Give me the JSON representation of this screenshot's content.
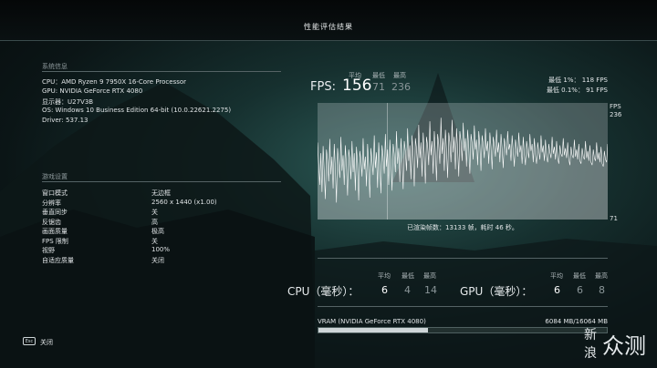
{
  "header": {
    "title": "性能评估结果"
  },
  "system_info": {
    "title": "系统信息",
    "lines": [
      "CPU：AMD Ryzen 9 7950X 16-Core Processor",
      "GPU: NVIDIA GeForce RTX 4080",
      "显示器：U27V3B",
      "OS: Windows 10 Business Edition 64-bit (10.0.22621.2275)",
      "Driver: 537.13"
    ]
  },
  "game_settings": {
    "title": "游戏设置",
    "rows": [
      {
        "label": "窗口模式",
        "value": "无边框"
      },
      {
        "label": "分辨率",
        "value": "2560 x 1440 (x1.00)"
      },
      {
        "label": "垂直同步",
        "value": "关"
      },
      {
        "label": "反锯齿",
        "value": "高"
      },
      {
        "label": "画面质量",
        "value": "极高"
      },
      {
        "label": "FPS 限制",
        "value": "关"
      },
      {
        "label": "视野",
        "value": "100%"
      },
      {
        "label": "自适应质量",
        "value": "关闭"
      }
    ]
  },
  "fps": {
    "label": "FPS:",
    "head_avg": "平均",
    "head_min": "最低",
    "head_max": "最高",
    "avg": "156",
    "min": "71",
    "max": "236",
    "low_1": "最低 1%： 118 FPS",
    "low_01": "最低 0.1%： 91 FPS"
  },
  "chart_data": {
    "type": "line",
    "y_top_label": "FPS",
    "y_top_value": "236",
    "y_bottom_value": "71",
    "ylim": [
      71,
      236
    ],
    "values": [
      180,
      150,
      120,
      165,
      110,
      175,
      140,
      100,
      170,
      155,
      125,
      185,
      135,
      160,
      115,
      178,
      145,
      95,
      172,
      150,
      130,
      188,
      140,
      162,
      120,
      176,
      148,
      105,
      170,
      158,
      128,
      182,
      138,
      165,
      112,
      174,
      150,
      98,
      168,
      156,
      132,
      186,
      142,
      160,
      118,
      178,
      146,
      102,
      172,
      154,
      134,
      190,
      144,
      166,
      116,
      180,
      150,
      108,
      176,
      160,
      136,
      192,
      146,
      170,
      120,
      184,
      152,
      112,
      178,
      164,
      138,
      196,
      150,
      172,
      124,
      186,
      156,
      114,
      182,
      168,
      140,
      200,
      154,
      176,
      128,
      190,
      160,
      118,
      186,
      172,
      144,
      205,
      158,
      180,
      132,
      194,
      164,
      122,
      188,
      176,
      148,
      210,
      162,
      182,
      136,
      196,
      166,
      126,
      192,
      178,
      150,
      215,
      164,
      186,
      140,
      198,
      170,
      130,
      194,
      180,
      152,
      212,
      166,
      188,
      142,
      200,
      172,
      132,
      196,
      182,
      154,
      208,
      168,
      186,
      146,
      198,
      174,
      136,
      192,
      180,
      156,
      204,
      170,
      184,
      148,
      196,
      176,
      140,
      190,
      178,
      158,
      200,
      168,
      182,
      150,
      194,
      174,
      142,
      188,
      176,
      160,
      198,
      166,
      180,
      152,
      192,
      172,
      144,
      186,
      174,
      162,
      196,
      170,
      178,
      154,
      190,
      168,
      146,
      184,
      172,
      160,
      194,
      166,
      176,
      150,
      188,
      164,
      148,
      182,
      170,
      158,
      192,
      168,
      178,
      152,
      186,
      162,
      150,
      180,
      168,
      156,
      190,
      166,
      176,
      154,
      184,
      160,
      152,
      178,
      166,
      158,
      188,
      164,
      174,
      156,
      182,
      158,
      150,
      176,
      164,
      160,
      186,
      162,
      172,
      158,
      180,
      156,
      148,
      174,
      162,
      158,
      184,
      160,
      170,
      156,
      178,
      154,
      150,
      172,
      160,
      156,
      182,
      158,
      168,
      154,
      176,
      152,
      148,
      170,
      158,
      154,
      180,
      156,
      166,
      152,
      174,
      150,
      146,
      168,
      156,
      152,
      178
    ]
  },
  "rendered": "已渲染帧数：13133 帧，耗时 46 秒。",
  "cpu": {
    "label": "CPU（毫秒）：",
    "head_avg": "平均",
    "head_min": "最低",
    "head_max": "最高",
    "avg": "6",
    "min": "4",
    "max": "14"
  },
  "gpu": {
    "label": "GPU（毫秒）：",
    "head_avg": "平均",
    "head_min": "最低",
    "head_max": "最高",
    "avg": "6",
    "min": "6",
    "max": "8"
  },
  "vram": {
    "label": "VRAM (NVIDIA GeForce RTX 4080)",
    "value": "6084 MB/16064 MB",
    "used_mb": 6084,
    "total_mb": 16064
  },
  "footer": {
    "key": "Esc",
    "close_label": "关闭"
  },
  "watermark": {
    "line1": "新",
    "line2": "浪",
    "brand": "众测"
  },
  "colors": {
    "accent": "#cfd6d8",
    "chart_bg": "#cdd5d6",
    "chart_line": "#ffffff",
    "bg": "#16302f"
  }
}
